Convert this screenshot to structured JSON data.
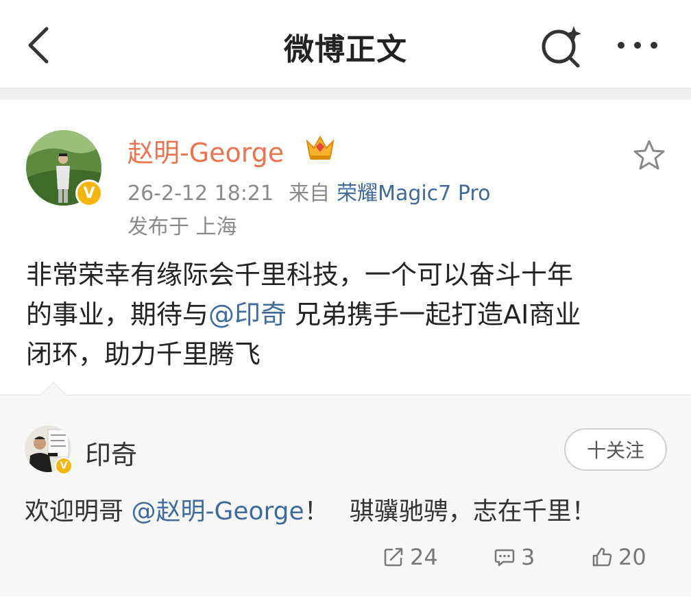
{
  "header": {
    "title": "微博正文",
    "back_icon": "back-arrow-icon",
    "search_icon": "search-sparkle-icon",
    "more_icon": "more-dots-icon"
  },
  "post": {
    "author": "赵明-George",
    "author_color": "#eb7350",
    "time": "26-2-12 18:21",
    "from_label": "来自",
    "device": "荣耀Magic7 Pro",
    "location": "发布于 上海",
    "text_line1": "非常荣幸有缘际会千里科技，一个可以奋斗十年",
    "text_line2_pre": "的事业，期待与",
    "text_line2_mention": "@印奇",
    "text_line2_post": " 兄弟携手一起打造AI商业",
    "text_line3": "闭环，助力千里腾飞",
    "verified_badge": "V",
    "link_color": "#3f6a9c"
  },
  "reply": {
    "author": "印奇",
    "verified_badge": "V",
    "follow_label": "十关注",
    "text_pre": "欢迎明哥 ",
    "text_mention": "@赵明-George",
    "text_mid": "！",
    "text_post": "骐骥驰骋，志在千里！",
    "repost_count": "24",
    "comment_count": "3",
    "like_count": "20"
  }
}
